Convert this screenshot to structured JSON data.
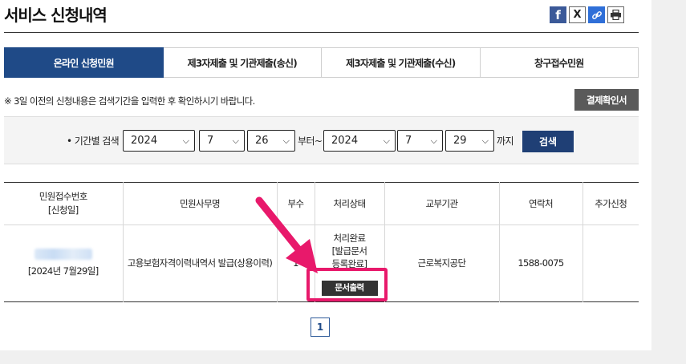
{
  "page": {
    "title": "서비스 신청내역"
  },
  "share": {
    "facebook": "f",
    "x": "X",
    "link": "🔗",
    "print": "⎙"
  },
  "tabs": [
    {
      "label": "온라인 신청민원"
    },
    {
      "label": "제3자제출 및 기관제출(송신)"
    },
    {
      "label": "제3자제출 및 기관제출(수신)"
    },
    {
      "label": "창구접수민원"
    }
  ],
  "notice": "※ 3일 이전의 신청내용은 검색기간을 입력한 후 확인하시기 바랍니다.",
  "receipt_button": "결제확인서",
  "search": {
    "label": "기간별 검색",
    "from_year": "2024",
    "from_month": "7",
    "from_day": "26",
    "from_suffix": "부터~",
    "to_year": "2024",
    "to_month": "7",
    "to_day": "29",
    "to_suffix": "까지",
    "button": "검색"
  },
  "table": {
    "headers": [
      "민원접수번호\n[신청일]",
      "민원사무명",
      "부수",
      "처리상태",
      "교부기관",
      "연락처",
      "추가신청"
    ],
    "header_col0_line1": "민원접수번호",
    "header_col0_line2": "[신청일]",
    "rows": [
      {
        "date": "[2024년 7월29일]",
        "name": "고용보험자격이력내역서 발급(상용이력)",
        "copies": "1",
        "status_line1": "처리완료",
        "status_line2": "[발급문서",
        "status_line3": "등록완료]",
        "print_button": "문서출력",
        "agency": "근로복지공단",
        "contact": "1588-0075",
        "extra": ""
      }
    ]
  },
  "pagination": {
    "current": "1"
  },
  "colors": {
    "accent": "#1f4a87",
    "highlight": "#e8196b"
  }
}
